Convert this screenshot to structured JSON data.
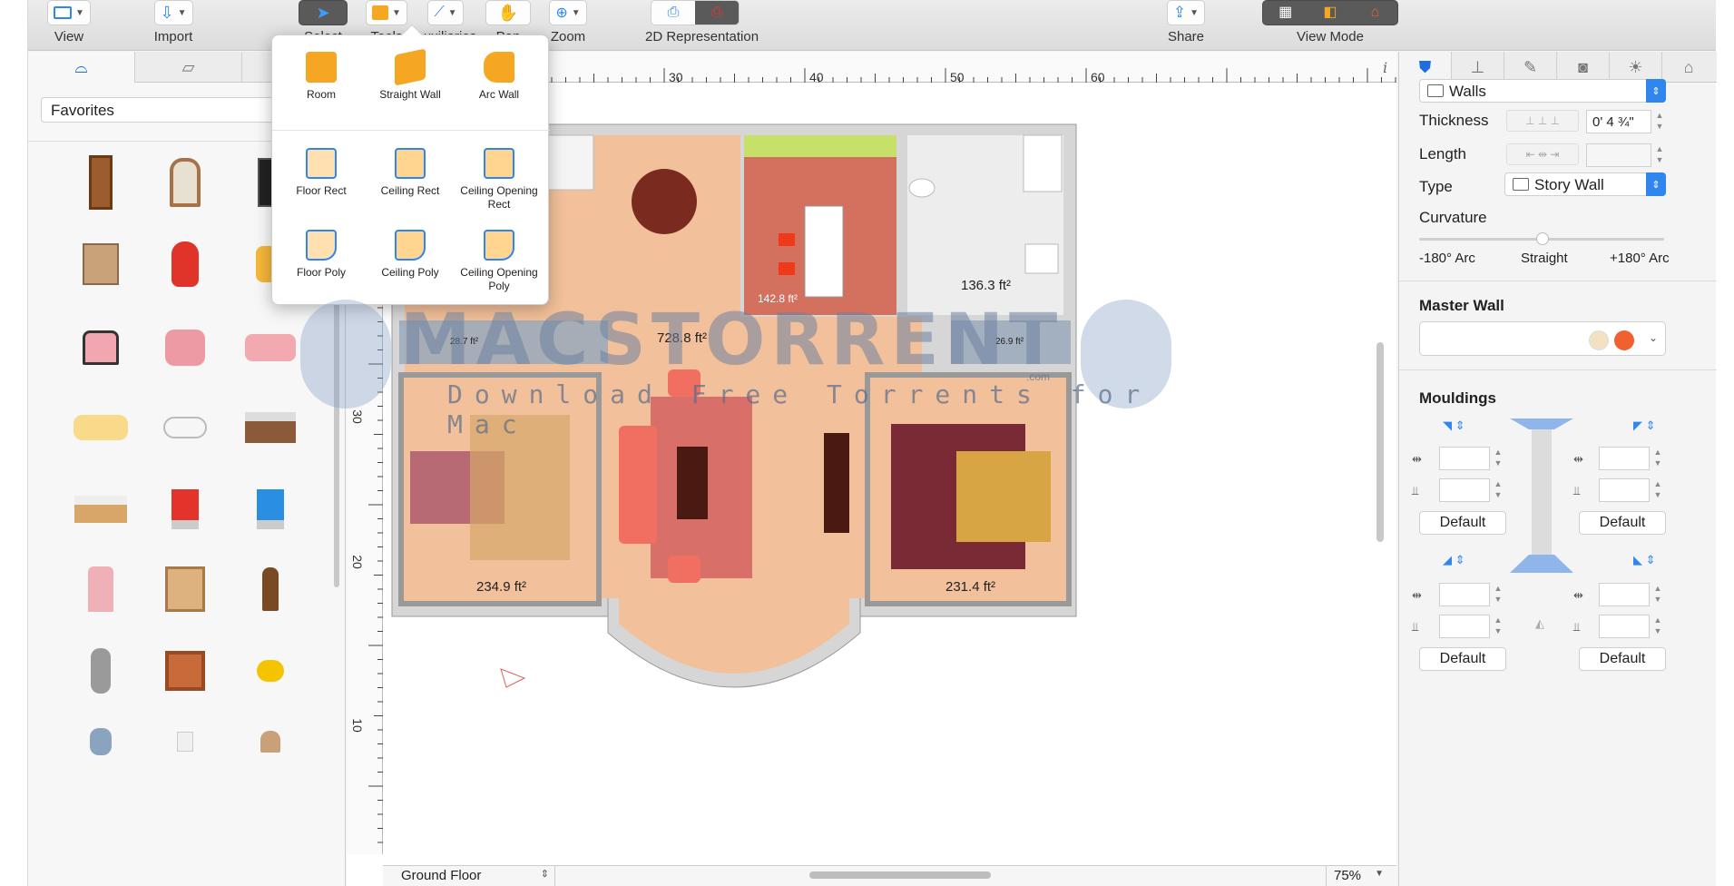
{
  "toolbar": {
    "view": "View",
    "import": "Import",
    "select": "Select",
    "tools": "Tools",
    "auxiliaries": "Auxiliaries",
    "pan": "Pan",
    "zoom": "Zoom",
    "representation": "2D Representation",
    "share": "Share",
    "view_mode": "View Mode"
  },
  "library": {
    "category": "Favorites",
    "items": [
      "door-icon",
      "window-icon",
      "tv-icon",
      "clock-icon",
      "egg-chair-icon",
      "armchair-icon",
      "lounge-chair-icon",
      "pink-armchair-icon",
      "pink-sofa-icon",
      "yellow-sofa-icon",
      "bathtub-icon",
      "bed-icon",
      "single-bed-icon",
      "red-chair-icon",
      "blue-chair-icon",
      "pink-chair-icon",
      "bookshelf-icon",
      "plant-icon",
      "lamp-icon",
      "fireplace-icon",
      "teapot-icon",
      "vase-icon",
      "cup-icon",
      "table-lamp-icon"
    ]
  },
  "tools_popover": {
    "items": [
      {
        "label": "Room"
      },
      {
        "label": "Straight Wall"
      },
      {
        "label": "Arc Wall"
      },
      {
        "label": "Floor Rect"
      },
      {
        "label": "Ceiling Rect"
      },
      {
        "label": "Ceiling Opening Rect"
      },
      {
        "label": "Floor Poly"
      },
      {
        "label": "Ceiling Poly"
      },
      {
        "label": "Ceiling Opening Poly"
      }
    ]
  },
  "canvas": {
    "ruler_top": [
      "30",
      "40",
      "50",
      "60"
    ],
    "ruler_left": [
      "30",
      "20",
      "10"
    ],
    "floor": "Ground Floor",
    "zoom": "75%",
    "rooms": {
      "main": "728.8 ft²",
      "kitchen": "142.8 ft²",
      "bath": "136.3 ft²",
      "hall_left": "28.7 ft²",
      "hall_right": "26.9 ft²",
      "bed_left": "234.9 ft²",
      "bed_right": "231.4 ft²"
    }
  },
  "inspector": {
    "header": "Walls",
    "thickness_label": "Thickness",
    "thickness_value": "0' 4 ¾\"",
    "length_label": "Length",
    "type_label": "Type",
    "type_value": "Story Wall",
    "curvature_label": "Curvature",
    "arc_left": "-180° Arc",
    "arc_mid": "Straight",
    "arc_right": "+180° Arc",
    "master_wall": "Master Wall",
    "mouldings": "Mouldings",
    "default": "Default"
  },
  "watermark": {
    "title": "MACSTORRENT",
    "subtitle": "Download Free Torrents for Mac",
    "com": ".com"
  }
}
